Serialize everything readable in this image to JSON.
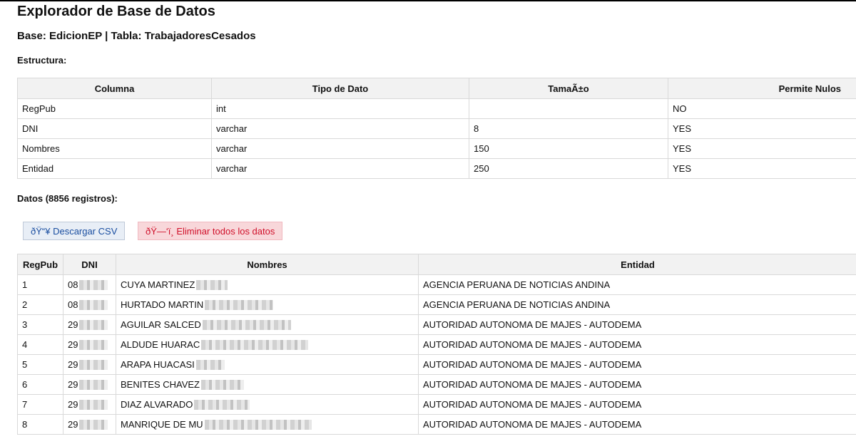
{
  "page": {
    "title": "Explorador de Base de Datos",
    "subtitle": "Base: EdicionEP | Tabla: TrabajadoresCesados",
    "structure_heading": "Estructura:",
    "data_heading": "Datos (8856 registros):"
  },
  "structure": {
    "headers": [
      "Columna",
      "Tipo de Dato",
      "TamaÃ±o",
      "Permite Nulos"
    ],
    "rows": [
      [
        "RegPub",
        "int",
        "",
        "NO"
      ],
      [
        "DNI",
        "varchar",
        "8",
        "YES"
      ],
      [
        "Nombres",
        "varchar",
        "150",
        "YES"
      ],
      [
        "Entidad",
        "varchar",
        "250",
        "YES"
      ]
    ]
  },
  "buttons": {
    "download_csv": "ðŸ“¥ Descargar CSV",
    "delete_all": "ðŸ—‘ï¸ Eliminar todos los datos"
  },
  "data": {
    "headers": [
      "RegPub",
      "DNI",
      "Nombres",
      "Entidad"
    ],
    "rows": [
      [
        "1",
        "08",
        "CUYA MARTINEZ",
        "AGENCIA PERUANA DE NOTICIAS ANDINA"
      ],
      [
        "2",
        "08",
        "HURTADO MARTIN",
        "AGENCIA PERUANA DE NOTICIAS ANDINA"
      ],
      [
        "3",
        "29",
        "AGUILAR SALCED",
        "AUTORIDAD AUTONOMA DE MAJES - AUTODEMA"
      ],
      [
        "4",
        "29",
        "ALDUDE HUARAC",
        "AUTORIDAD AUTONOMA DE MAJES - AUTODEMA"
      ],
      [
        "5",
        "29",
        "ARAPA HUACASI",
        "AUTORIDAD AUTONOMA DE MAJES - AUTODEMA"
      ],
      [
        "6",
        "29",
        "BENITES CHAVEZ",
        "AUTORIDAD AUTONOMA DE MAJES - AUTODEMA"
      ],
      [
        "7",
        "29",
        "DIAZ ALVARADO",
        "AUTORIDAD AUTONOMA DE MAJES - AUTODEMA"
      ],
      [
        "8",
        "29",
        "MANRIQUE DE MU",
        "AUTORIDAD AUTONOMA DE MAJES - AUTODEMA"
      ]
    ]
  },
  "colors": {
    "csv_button_text": "#1a4ea0",
    "delete_button_text": "#d0102a",
    "delete_button_bg": "#f8d7da",
    "header_bg": "#f2f2f2"
  }
}
